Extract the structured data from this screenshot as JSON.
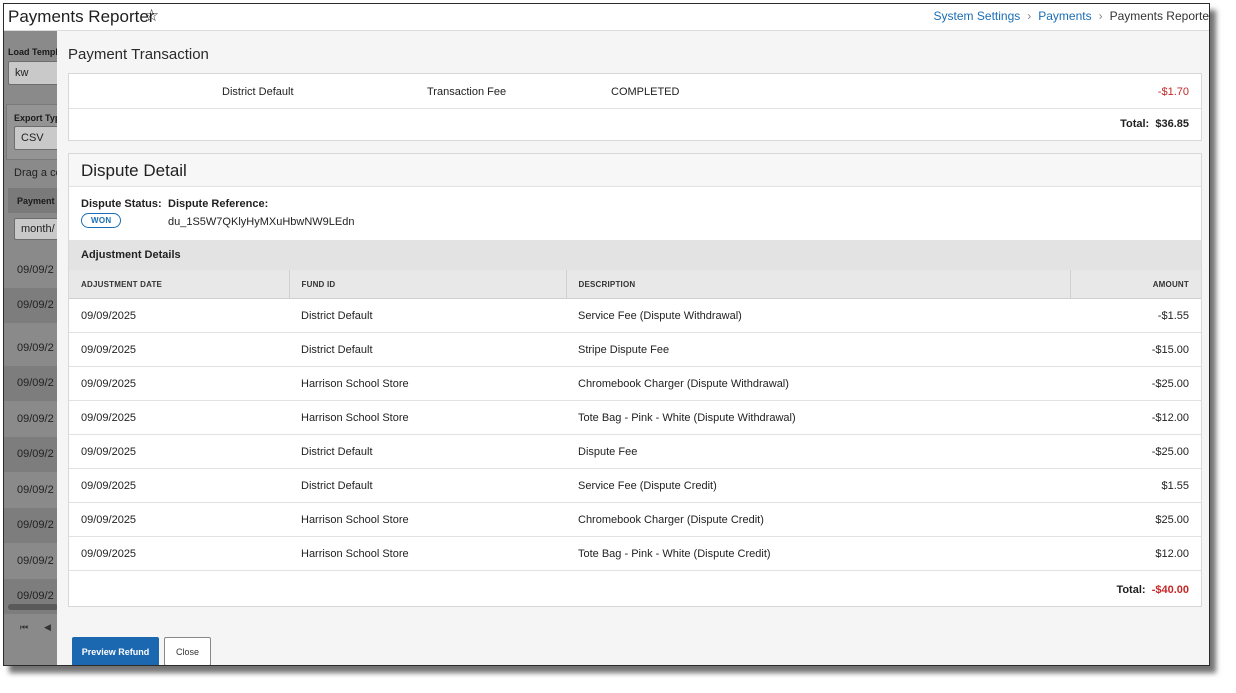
{
  "app": {
    "title": "Payments Reporter",
    "favorite_icon": "star-outline-icon"
  },
  "breadcrumb": {
    "items": [
      "System Settings",
      "Payments",
      "Payments Reporter"
    ]
  },
  "background_panel": {
    "load_template_label": "Load Templa",
    "load_template_value": "kw",
    "export_type_label": "Export Typ",
    "export_type_value": "CSV",
    "drag_hint": "Drag a co",
    "payment_col_header": "Payment",
    "date_filter_placeholder": "month/",
    "rows": [
      "09/09/2",
      "09/09/2",
      "09/09/2",
      "09/09/2",
      "09/09/2",
      "09/09/2",
      "09/09/2",
      "09/09/2",
      "09/09/2",
      "09/09/2"
    ]
  },
  "modal": {
    "title": "Payment Transaction",
    "transaction": {
      "row": {
        "fund": "District Default",
        "type": "Transaction Fee",
        "status": "COMPLETED",
        "amount": "-$1.70"
      },
      "total_label": "Total:",
      "total_value": "$36.85"
    },
    "dispute": {
      "title": "Dispute Detail",
      "status_label": "Dispute Status:",
      "status_value": "WON",
      "reference_label": "Dispute Reference:",
      "reference_value": "du_1S5W7QKlyHyMXuHbwNW9LEdn",
      "adjustments_title": "Adjustment Details",
      "columns": [
        "ADJUSTMENT DATE",
        "FUND ID",
        "DESCRIPTION",
        "AMOUNT"
      ],
      "rows": [
        {
          "date": "09/09/2025",
          "fund": "District Default",
          "description": "Service Fee (Dispute Withdrawal)",
          "amount": "-$1.55",
          "negative": true
        },
        {
          "date": "09/09/2025",
          "fund": "District Default",
          "description": "Stripe Dispute Fee",
          "amount": "-$15.00",
          "negative": true
        },
        {
          "date": "09/09/2025",
          "fund": "Harrison School Store",
          "description": "Chromebook Charger (Dispute Withdrawal)",
          "amount": "-$25.00",
          "negative": true
        },
        {
          "date": "09/09/2025",
          "fund": "Harrison School Store",
          "description": "Tote Bag - Pink - White (Dispute Withdrawal)",
          "amount": "-$12.00",
          "negative": true
        },
        {
          "date": "09/09/2025",
          "fund": "District Default",
          "description": "Dispute Fee",
          "amount": "-$25.00",
          "negative": true
        },
        {
          "date": "09/09/2025",
          "fund": "District Default",
          "description": "Service Fee (Dispute Credit)",
          "amount": "$1.55",
          "negative": false
        },
        {
          "date": "09/09/2025",
          "fund": "Harrison School Store",
          "description": "Chromebook Charger (Dispute Credit)",
          "amount": "$25.00",
          "negative": false
        },
        {
          "date": "09/09/2025",
          "fund": "Harrison School Store",
          "description": "Tote Bag - Pink - White (Dispute Credit)",
          "amount": "$12.00",
          "negative": false
        }
      ],
      "total_label": "Total:",
      "total_value": "-$40.00"
    },
    "buttons": {
      "preview_refund": "Preview Refund",
      "close": "Close"
    }
  },
  "colors": {
    "accent": "#1b67b0",
    "link": "#1a6db5",
    "negative": "#c62828"
  }
}
